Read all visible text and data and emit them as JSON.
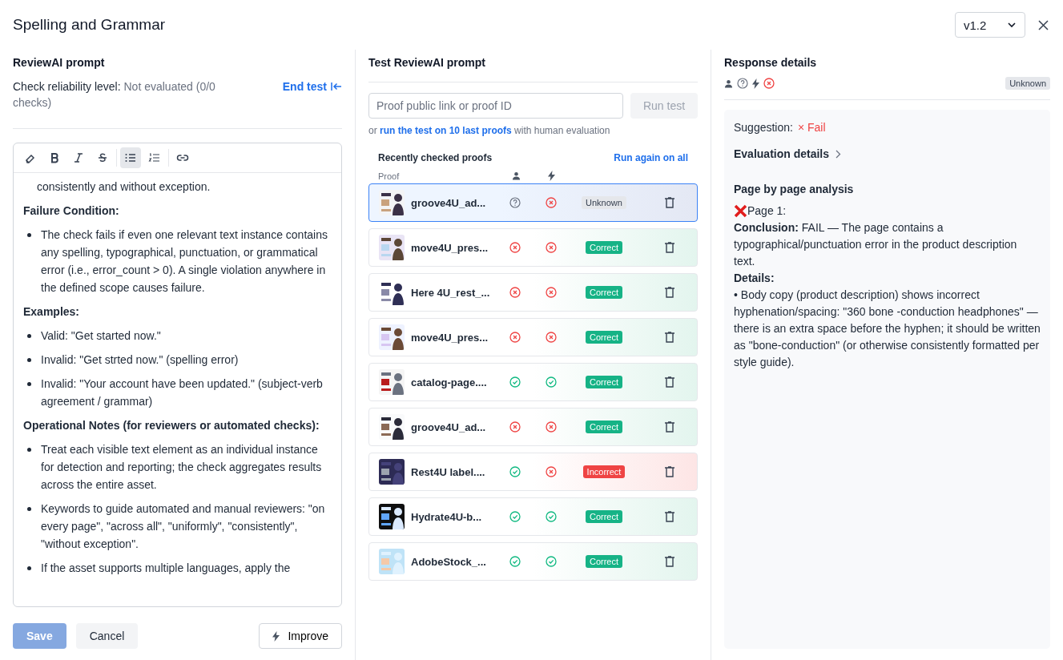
{
  "window": {
    "title": "Spelling and Grammar",
    "version": "v1.2"
  },
  "prompt": {
    "title": "ReviewAI prompt",
    "reliability_label": "Check reliability level:",
    "reliability_value": "Not evaluated (0/0 checks)",
    "end_test": "End test",
    "toolbar": [
      {
        "kind": "eraser",
        "selected": false
      },
      {
        "kind": "bold",
        "selected": false
      },
      {
        "kind": "italic",
        "selected": false
      },
      {
        "kind": "strike",
        "selected": false
      },
      {
        "kind": "bullets",
        "selected": true
      },
      {
        "kind": "numbers",
        "selected": false
      },
      {
        "kind": "link",
        "selected": false
      }
    ],
    "blocks": [
      {
        "kind": "continuation",
        "text": "consistently and without exception."
      },
      {
        "kind": "heading",
        "text": "Failure Condition:"
      },
      {
        "kind": "bullet",
        "text": "The check fails if even one relevant text instance contains any spelling, typographical, punctuation, or grammatical error (i.e., error_count > 0). A single violation anywhere in the defined scope causes failure."
      },
      {
        "kind": "heading",
        "text": "Examples:"
      },
      {
        "kind": "bullet",
        "text": "Valid: \"Get started now.\""
      },
      {
        "kind": "bullet",
        "text": "Invalid: \"Get strted now.\" (spelling error)"
      },
      {
        "kind": "bullet",
        "text": "Invalid: \"Your account have been updated.\" (subject-verb agreement / grammar)"
      },
      {
        "kind": "heading",
        "text": "Operational Notes (for reviewers or automated checks):"
      },
      {
        "kind": "bullet",
        "text": "Treat each visible text element as an individual instance for detection and reporting; the check aggregates results across the entire asset."
      },
      {
        "kind": "bullet",
        "text": "Keywords to guide automated and manual reviewers: \"on every page\", \"across all\", \"uniformly\", \"consistently\", \"without exception\"."
      },
      {
        "kind": "bullet",
        "text": "If the asset supports multiple languages, apply the"
      }
    ],
    "buttons": {
      "save": "Save",
      "cancel": "Cancel",
      "improve": "Improve"
    }
  },
  "test": {
    "title": "Test ReviewAI prompt",
    "input": {
      "placeholder": "Proof public link or proof ID"
    },
    "run": "Run test",
    "hint_prefix": "or",
    "hint_link": "run the test on 10 last proofs",
    "hint_suffix": "with human evaluation",
    "list_title": "Recently checked proofs",
    "run_all": "Run again on all",
    "column_proof": "Proof",
    "rows": [
      {
        "kind": "unknown",
        "name": "groove4U_ad...",
        "human": {
          "kind": "unknown"
        },
        "ai": {
          "kind": "fail"
        },
        "verdict": "Unknown",
        "selected": true
      },
      {
        "kind": "correct",
        "name": "move4U_pres...",
        "human": {
          "kind": "fail"
        },
        "ai": {
          "kind": "fail"
        },
        "verdict": "Correct",
        "selected": false
      },
      {
        "kind": "correct",
        "name": "Here 4U_rest_...",
        "human": {
          "kind": "fail"
        },
        "ai": {
          "kind": "fail"
        },
        "verdict": "Correct",
        "selected": false
      },
      {
        "kind": "correct",
        "name": "move4U_pres...",
        "human": {
          "kind": "fail"
        },
        "ai": {
          "kind": "fail"
        },
        "verdict": "Correct",
        "selected": false
      },
      {
        "kind": "correct",
        "name": "catalog-page....",
        "human": {
          "kind": "pass"
        },
        "ai": {
          "kind": "pass"
        },
        "verdict": "Correct",
        "selected": false
      },
      {
        "kind": "correct",
        "name": "groove4U_ad...",
        "human": {
          "kind": "fail"
        },
        "ai": {
          "kind": "fail"
        },
        "verdict": "Correct",
        "selected": false
      },
      {
        "kind": "incorrect",
        "name": "Rest4U label....",
        "human": {
          "kind": "pass"
        },
        "ai": {
          "kind": "fail"
        },
        "verdict": "Incorrect",
        "selected": false
      },
      {
        "kind": "correct",
        "name": "Hydrate4U-b...",
        "human": {
          "kind": "pass"
        },
        "ai": {
          "kind": "pass"
        },
        "verdict": "Correct",
        "selected": false
      },
      {
        "kind": "correct",
        "name": "AdobeStock_...",
        "human": {
          "kind": "pass"
        },
        "ai": {
          "kind": "pass"
        },
        "verdict": "Correct",
        "selected": false
      }
    ]
  },
  "response": {
    "title": "Response details",
    "human": {
      "kind": "unknown"
    },
    "ai": {
      "kind": "fail"
    },
    "tag": "Unknown",
    "suggestion_label": "Suggestion:",
    "suggestion": "× Fail",
    "evaluation": "Evaluation details",
    "analysis_title": "Page by page analysis",
    "page": "Page 1:",
    "conclusion": "**Conclusion:** FAIL — The page contains a typographical/punctuation error in the product description text.",
    "details_label": "Details:",
    "details": "• Body copy (product description) shows incorrect hyphenation/spacing: \"360 bone -conduction headphones\" — there is an extra space before the hyphen; it should be written as \"bone-conduction\" (or otherwise consistently formatted per style guide)."
  }
}
